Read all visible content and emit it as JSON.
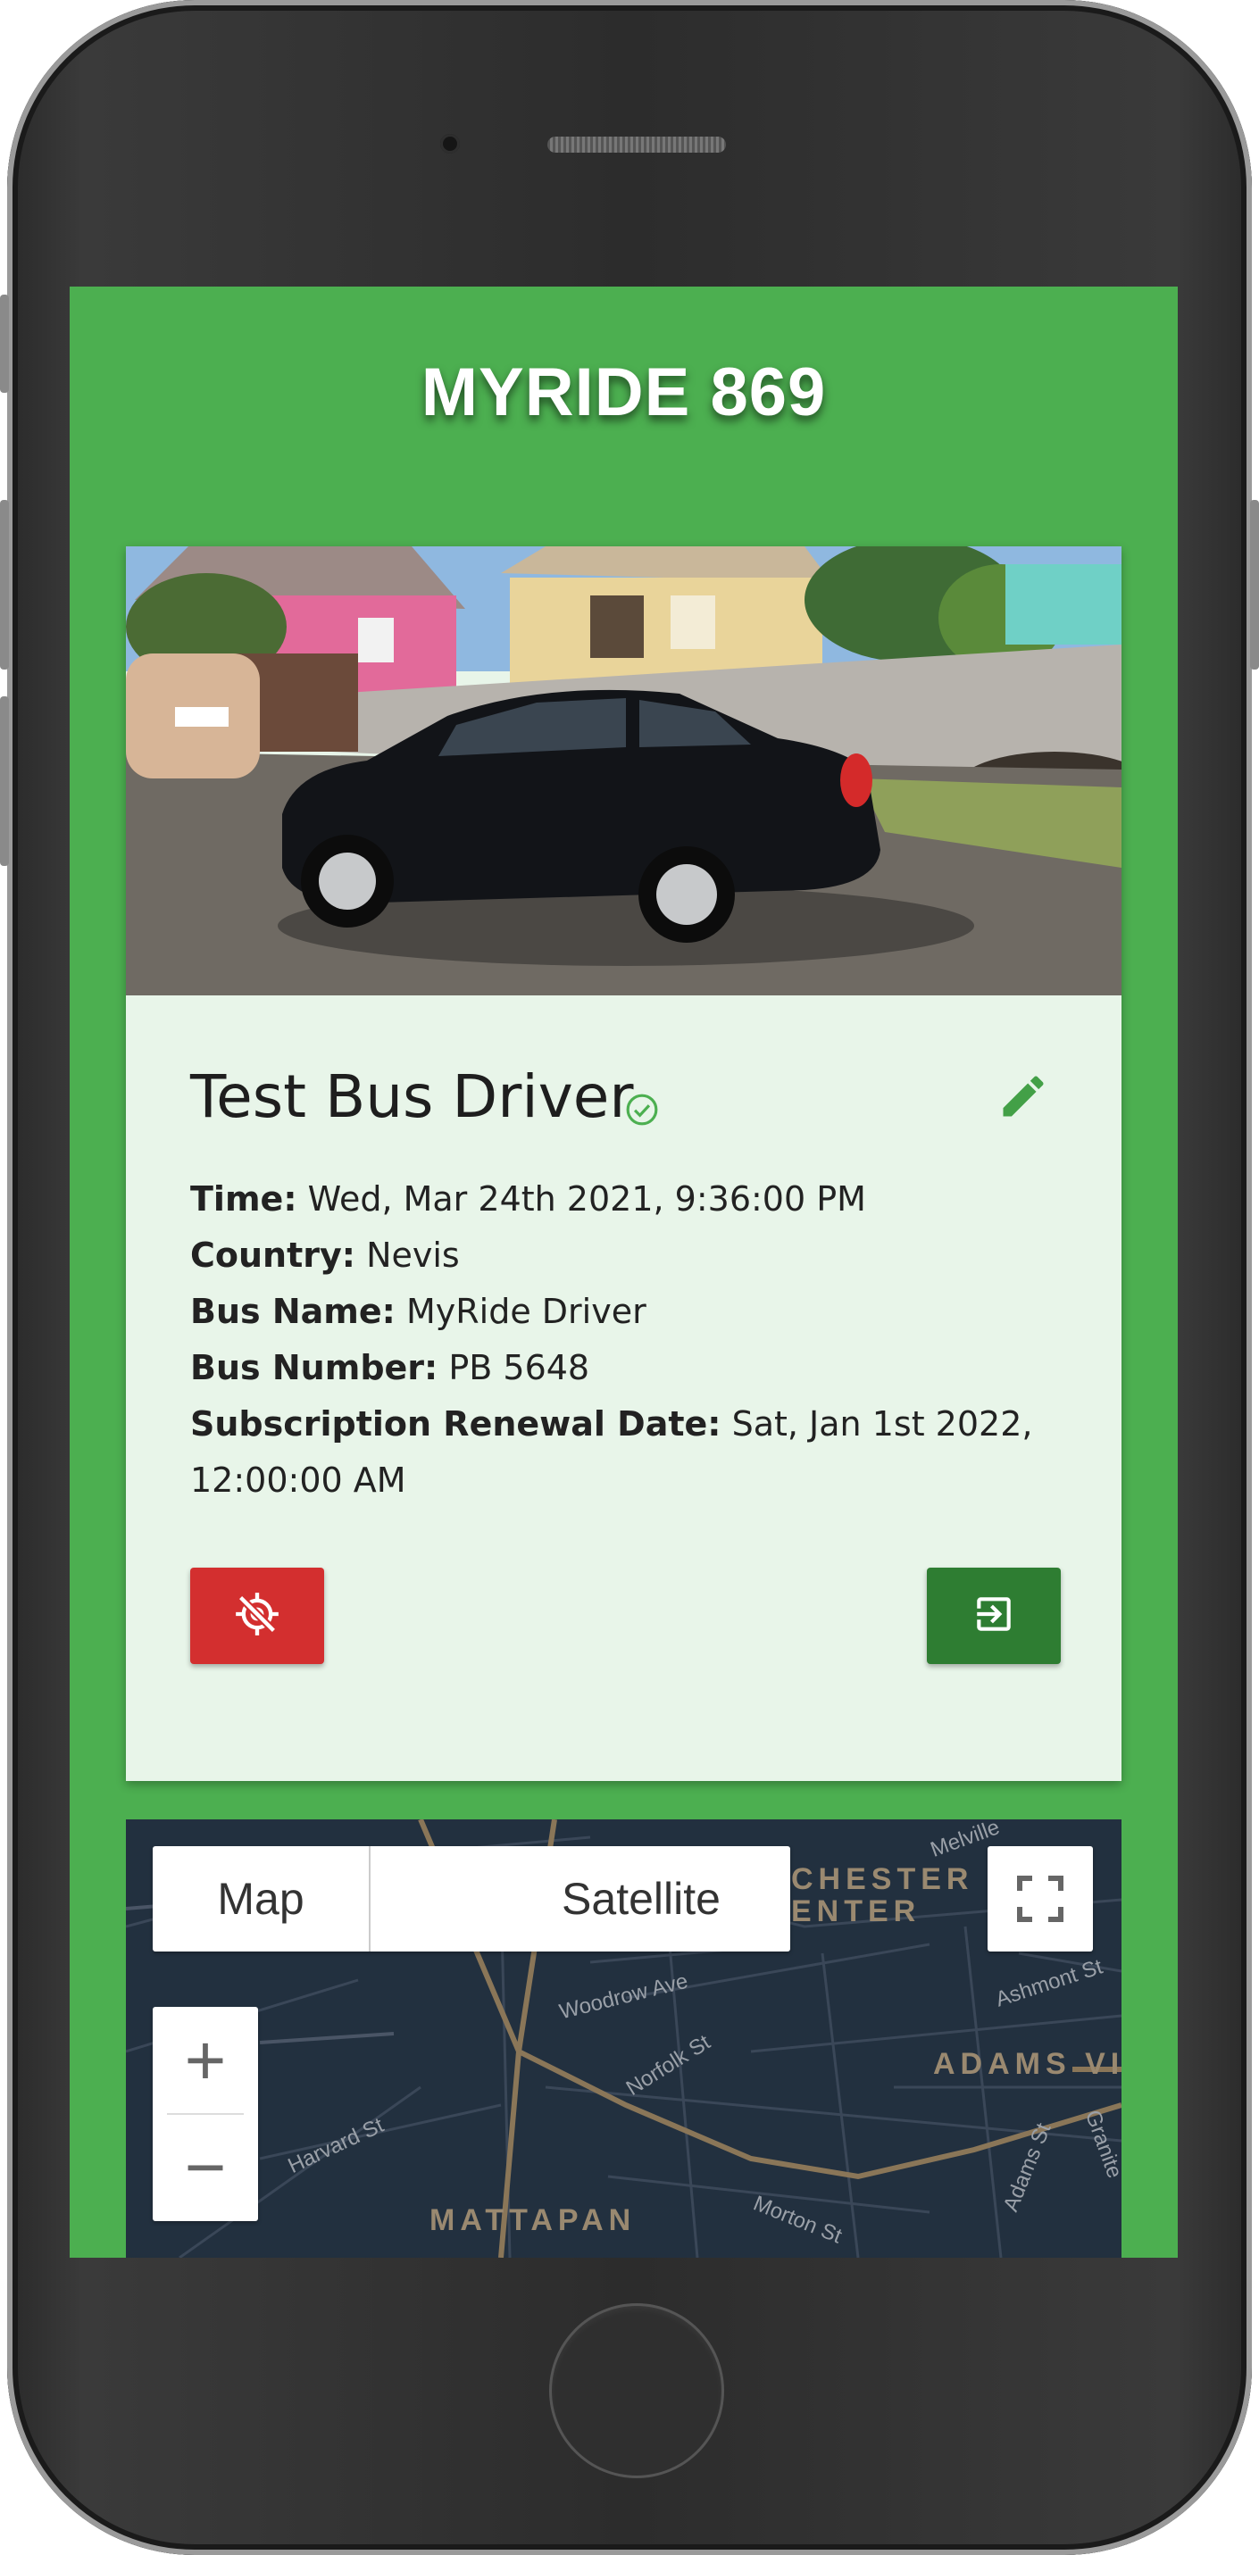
{
  "app": {
    "title": "MYRIDE 869"
  },
  "driver": {
    "name": "Test Bus Driver",
    "fields": [
      {
        "label": "Time:",
        "value": "Wed, Mar 24th 2021, 9:36:00 PM"
      },
      {
        "label": "Country:",
        "value": "Nevis"
      },
      {
        "label": "Bus Name:",
        "value": "MyRide Driver"
      },
      {
        "label": "Bus Number:",
        "value": "PB 5648"
      },
      {
        "label": "Subscription Renewal Date:",
        "value": "Sat, Jan 1st 2022, 12:00:00 AM"
      }
    ]
  },
  "actions": {
    "stop_tracking_icon": "location-off-icon",
    "logout_icon": "exit-to-app-icon"
  },
  "map": {
    "type_options": [
      "Map",
      "Satellite"
    ],
    "zoom_in": "+",
    "zoom_out": "−",
    "labels": {
      "area_1": "CHESTER",
      "area_2": "ENTER",
      "area_3": "ADAMS VI",
      "area_4": "MATTAPAN",
      "street_1": "Woodrow Ave",
      "street_2": "Norfolk St",
      "street_3": "Harvard St",
      "street_4": "Morton St",
      "street_5": "Ashmont St",
      "street_6": "Melville",
      "street_7": "Adams St",
      "street_8": "Granite"
    }
  },
  "colors": {
    "primary": "#4caf50",
    "card_bg": "#e8f5e9",
    "danger": "#d32f2f",
    "success_dark": "#2e7d32",
    "map_bg": "#22303f"
  }
}
